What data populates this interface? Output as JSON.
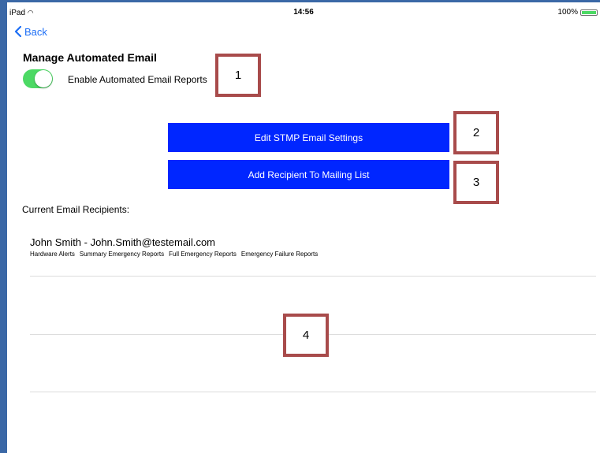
{
  "status_bar": {
    "device": "iPad",
    "time": "14:56",
    "battery_label": "100%",
    "battery_level": 1.0
  },
  "nav": {
    "back_label": "Back"
  },
  "section": {
    "title": "Manage Automated Email",
    "toggle_label": "Enable Automated Email Reports",
    "toggle_on": true
  },
  "buttons": {
    "edit_smtp": "Edit STMP Email Settings",
    "add_recipient": "Add Recipient To Mailing List"
  },
  "recipients": {
    "header": "Current Email Recipients:",
    "items": [
      {
        "name_email": "John Smith - John.Smith@testemail.com",
        "tags": [
          "Hardware Alerts",
          "Summary Emergency Reports",
          "Full Emergency Reports",
          "Emergency Failure Reports"
        ]
      }
    ]
  },
  "annotations": [
    "1",
    "2",
    "3",
    "4"
  ],
  "colors": {
    "button_blue": "#0026ff",
    "toggle_green": "#4cd964",
    "link_blue": "#1e6ff5",
    "annotation_border": "#a84b4b",
    "frame": "#3b68a6"
  }
}
